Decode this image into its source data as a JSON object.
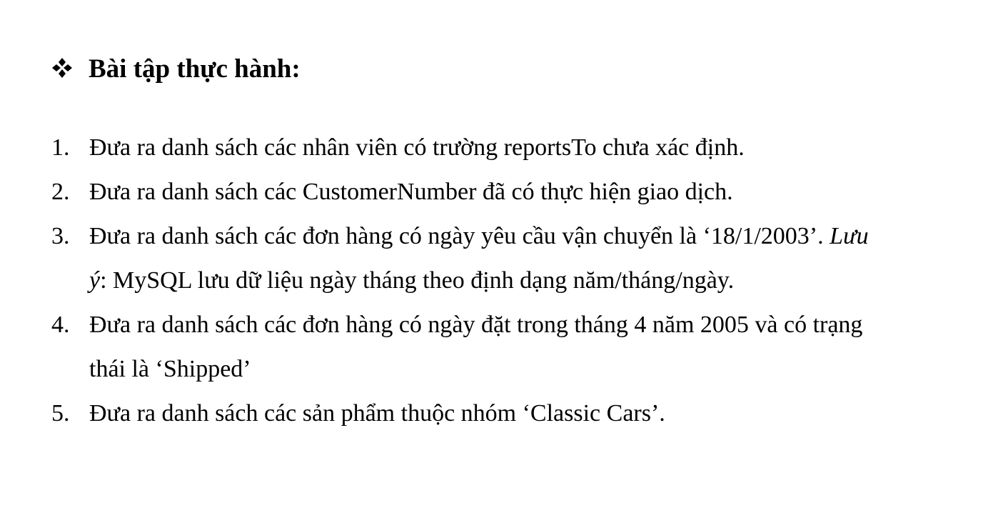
{
  "heading": {
    "bullet_icon": "four-diamond-bullet-icon",
    "title": "Bài tập thực hành:"
  },
  "items": [
    {
      "number": "1.",
      "line1": "Đưa ra danh sách các nhân viên có trường reportsTo chưa xác định."
    },
    {
      "number": "2.",
      "line1": "Đưa ra danh sách các CustomerNumber đã có thực hiện giao dịch."
    },
    {
      "number": "3.",
      "line1_text": "Đưa ra danh sách các đơn hàng có ngày yêu cầu vận chuyển là ‘18/1/2003’.  ",
      "note_label_part1": "Lưu",
      "note_label_part2": "ý",
      "note_text": ": MySQL lưu dữ liệu ngày tháng theo định dạng năm/tháng/ngày."
    },
    {
      "number": "4.",
      "line1": "Đưa ra danh sách các đơn hàng có ngày đặt trong tháng 4 năm 2005 và có trạng",
      "line2": "thái là ‘Shipped’"
    },
    {
      "number": "5.",
      "line1": "Đưa ra danh sách các sản phẩm thuộc nhóm ‘Classic Cars’."
    }
  ]
}
